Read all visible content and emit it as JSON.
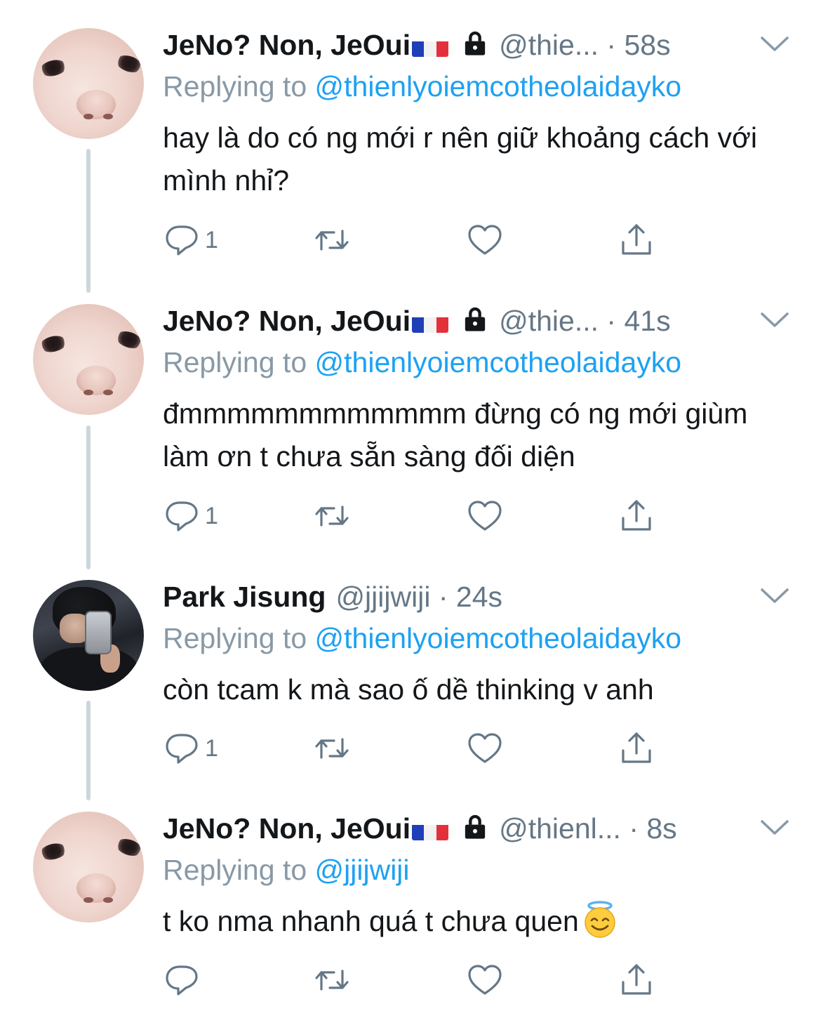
{
  "tweets": [
    {
      "name": "JeNo? Non, JeOui",
      "handle": "@thie...",
      "time": "· 58s",
      "replying_label": "Replying to",
      "replying_to": "@thienlyoiemcotheolaidayko",
      "text": "hay là do có ng mới r nên giữ khoảng cách với mình nhỉ?",
      "reply_count": "1",
      "avatar": "face",
      "flag": "france-flag",
      "locked": true
    },
    {
      "name": "JeNo? Non, JeOui",
      "handle": "@thie...",
      "time": "· 41s",
      "replying_label": "Replying to",
      "replying_to": "@thienlyoiemcotheolaidayko",
      "text": "đmmmmmmmmmmmm đừng có ng mới giùm làm ơn t chưa sẵn sàng đối diện",
      "reply_count": "1",
      "avatar": "face",
      "flag": "france-flag",
      "locked": true
    },
    {
      "name": "Park Jisung",
      "handle": "@jjijwiji",
      "time": "· 24s",
      "replying_label": "Replying to",
      "replying_to": "@thienlyoiemcotheolaidayko",
      "text": "còn tcam k mà sao ố dề thinking v anh",
      "reply_count": "1",
      "avatar": "photo",
      "locked": false
    },
    {
      "name": "JeNo? Non, JeOui",
      "handle": "@thienl...",
      "time": "· 8s",
      "replying_label": "Replying to",
      "replying_to": "@jjijwiji",
      "text": "t ko nma nhanh quá t chưa quen",
      "reply_count": "",
      "avatar": "face",
      "flag": "france-flag",
      "locked": true,
      "trailing_emoji": "smiling-face-with-halo"
    }
  ],
  "colors": {
    "mention": "#1da1f2",
    "secondary": "#657786",
    "thread_line": "#ccd6dd"
  },
  "icons": [
    "reply-icon",
    "retweet-icon",
    "like-icon",
    "share-icon",
    "chevron-down-icon",
    "lock-icon"
  ]
}
